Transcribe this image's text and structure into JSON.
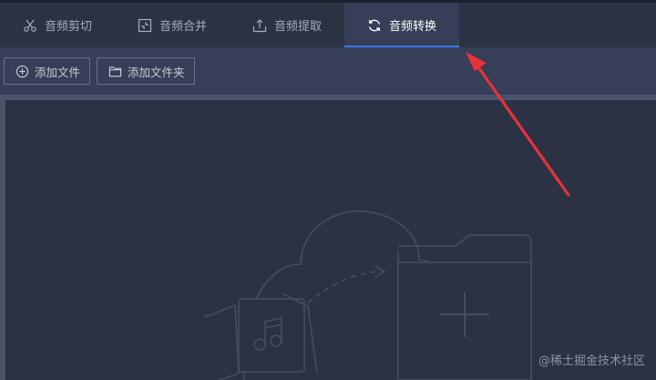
{
  "tabs": [
    {
      "label": "音频剪切",
      "icon": "scissors-icon"
    },
    {
      "label": "音频合并",
      "icon": "merge-icon"
    },
    {
      "label": "音频提取",
      "icon": "upload-icon"
    },
    {
      "label": "音频转换",
      "icon": "refresh-icon",
      "active": true
    }
  ],
  "toolbar": {
    "add_file_label": "添加文件",
    "add_folder_label": "添加文件夹"
  },
  "watermark": "@稀土掘金技术社区",
  "colors": {
    "accent": "#3c7ae6",
    "annotation_arrow": "#e8323a"
  }
}
